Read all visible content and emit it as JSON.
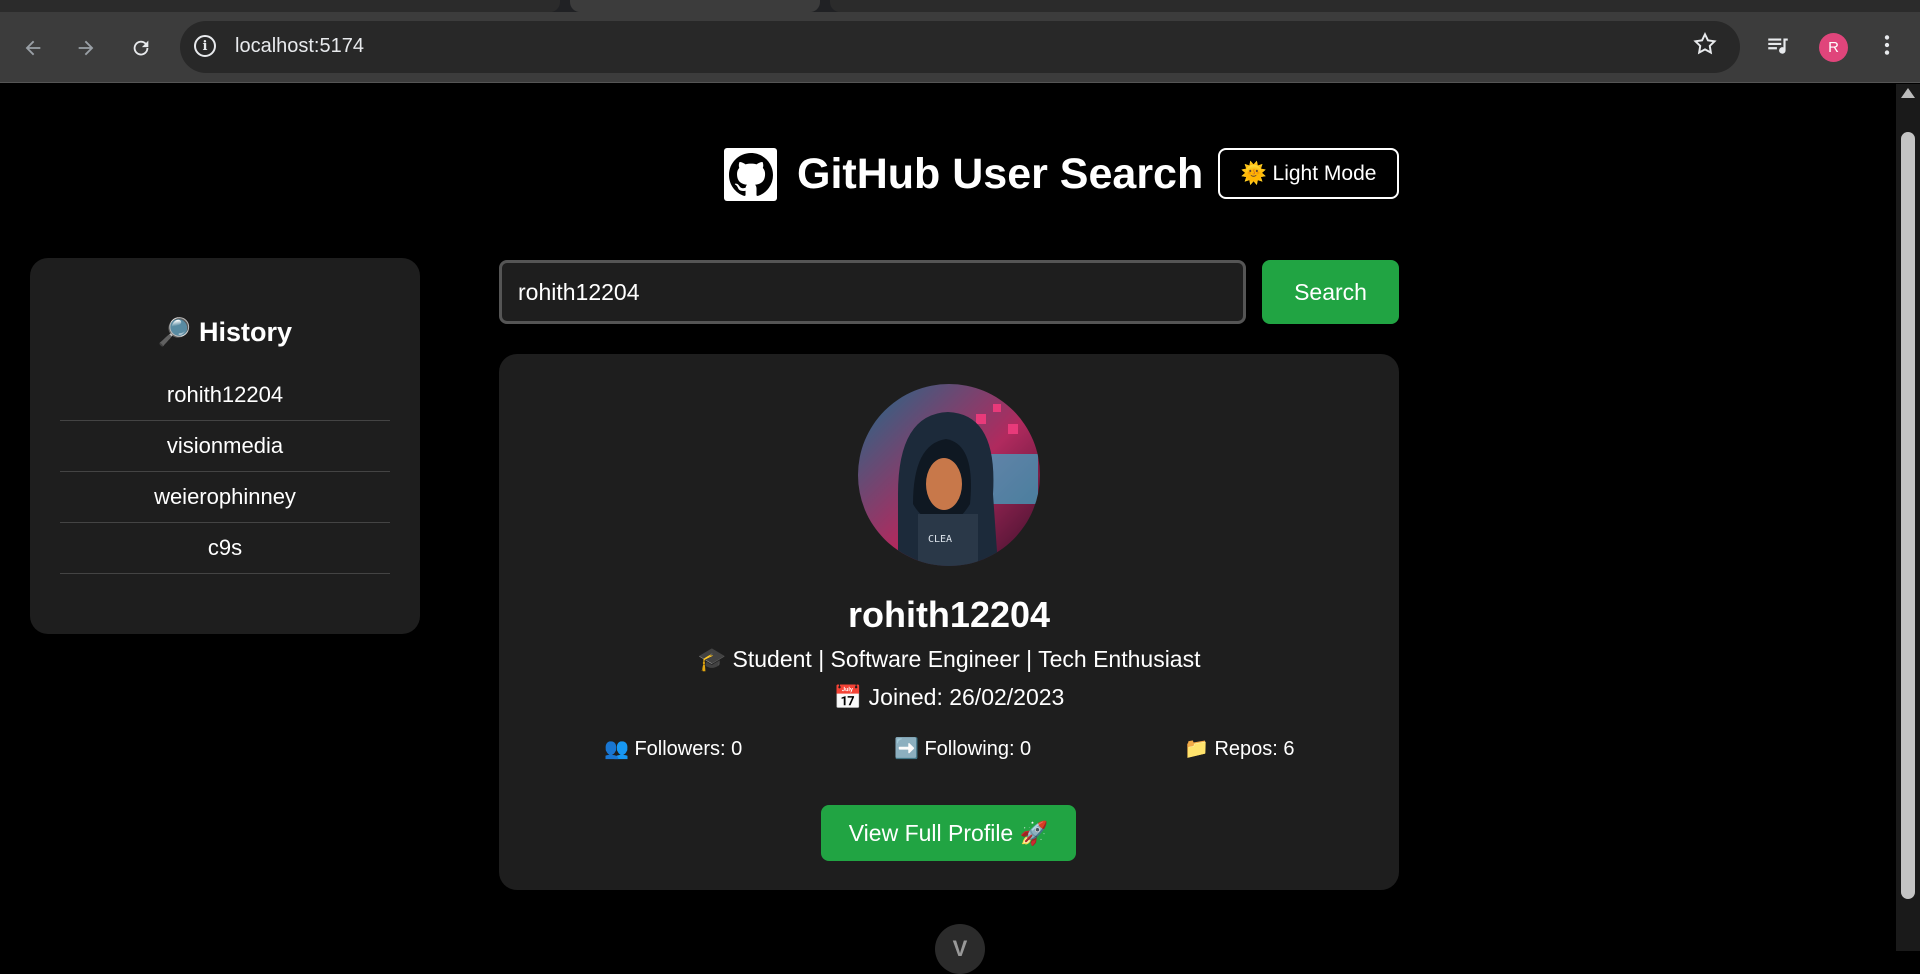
{
  "browser": {
    "url": "localhost:5174",
    "profile_initial": "R"
  },
  "header": {
    "title": "GitHub User Search",
    "mode_button": "🌞 Light Mode"
  },
  "history": {
    "title": "🔎 History",
    "items": [
      "rohith12204",
      "visionmedia",
      "weierophinney",
      "c9s"
    ]
  },
  "search": {
    "value": "rohith12204",
    "button_label": "Search"
  },
  "profile": {
    "username": "rohith12204",
    "bio": "🎓 Student | Software Engineer | Tech Enthusiast",
    "joined": "📅 Joined: 26/02/2023",
    "followers": "👥 Followers: 0",
    "following": "➡️ Following: 0",
    "repos": "📁 Repos: 6",
    "view_button": "View Full Profile 🚀"
  },
  "colors": {
    "accent_green": "#21a443",
    "card_bg": "#1e1e1e",
    "page_bg": "#000000"
  }
}
